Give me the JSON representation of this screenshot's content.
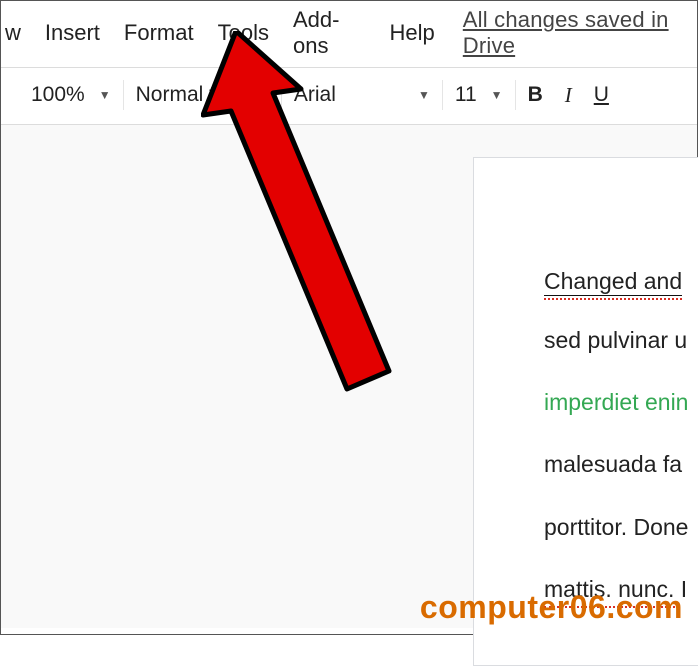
{
  "menubar": {
    "items": [
      "w",
      "Insert",
      "Format",
      "Tools",
      "Add-ons",
      "Help"
    ],
    "save_status": "All changes saved in Drive"
  },
  "toolbar": {
    "zoom": "100%",
    "style": "Normal text",
    "font": "Arial",
    "font_size": "11",
    "bold": "B",
    "italic": "I",
    "underline": "U"
  },
  "document": {
    "heading": "Changed and",
    "lines": [
      {
        "text": "sed pulvinar u",
        "class": ""
      },
      {
        "text": "imperdiet enin",
        "class": "green-text"
      },
      {
        "text": "malesuada fa",
        "class": ""
      },
      {
        "text": "porttitor. Done",
        "class": ""
      },
      {
        "text": "mattis. nunc. I",
        "class": "last-line"
      }
    ]
  },
  "watermark": "computer06.com",
  "colors": {
    "arrow": "#e30000",
    "arrow_stroke": "#000000"
  }
}
